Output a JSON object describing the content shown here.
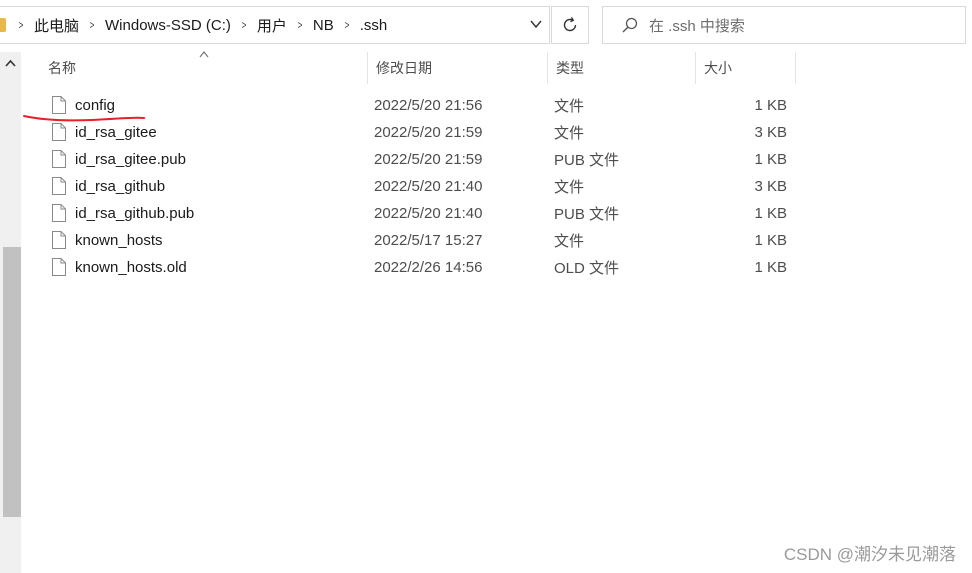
{
  "address_bar": {
    "crumbs": [
      "此电脑",
      "Windows-SSD (C:)",
      "用户",
      "NB",
      ".ssh"
    ]
  },
  "search": {
    "placeholder": "在 .ssh 中搜索"
  },
  "columns": {
    "name": "名称",
    "date": "修改日期",
    "type": "类型",
    "size": "大小"
  },
  "files": [
    {
      "name": "config",
      "date": "2022/5/20 21:56",
      "type": "文件",
      "size": "1 KB"
    },
    {
      "name": "id_rsa_gitee",
      "date": "2022/5/20 21:59",
      "type": "文件",
      "size": "3 KB"
    },
    {
      "name": "id_rsa_gitee.pub",
      "date": "2022/5/20 21:59",
      "type": "PUB 文件",
      "size": "1 KB"
    },
    {
      "name": "id_rsa_github",
      "date": "2022/5/20 21:40",
      "type": "文件",
      "size": "3 KB"
    },
    {
      "name": "id_rsa_github.pub",
      "date": "2022/5/20 21:40",
      "type": "PUB 文件",
      "size": "1 KB"
    },
    {
      "name": "known_hosts",
      "date": "2022/5/17 15:27",
      "type": "文件",
      "size": "1 KB"
    },
    {
      "name": "known_hosts.old",
      "date": "2022/2/26 14:56",
      "type": "OLD 文件",
      "size": "1 KB"
    }
  ],
  "watermark": "CSDN @潮汐未见潮落",
  "colors": {
    "annotation": "#e8202a",
    "folder": "#e8b84a"
  },
  "icons": {
    "breadcrumb_separator": "chevron-right-icon",
    "address_dropdown": "chevron-down-icon",
    "refresh": "refresh-icon",
    "search": "search-icon",
    "sort": "sort-up-icon",
    "file": "file-icon"
  }
}
